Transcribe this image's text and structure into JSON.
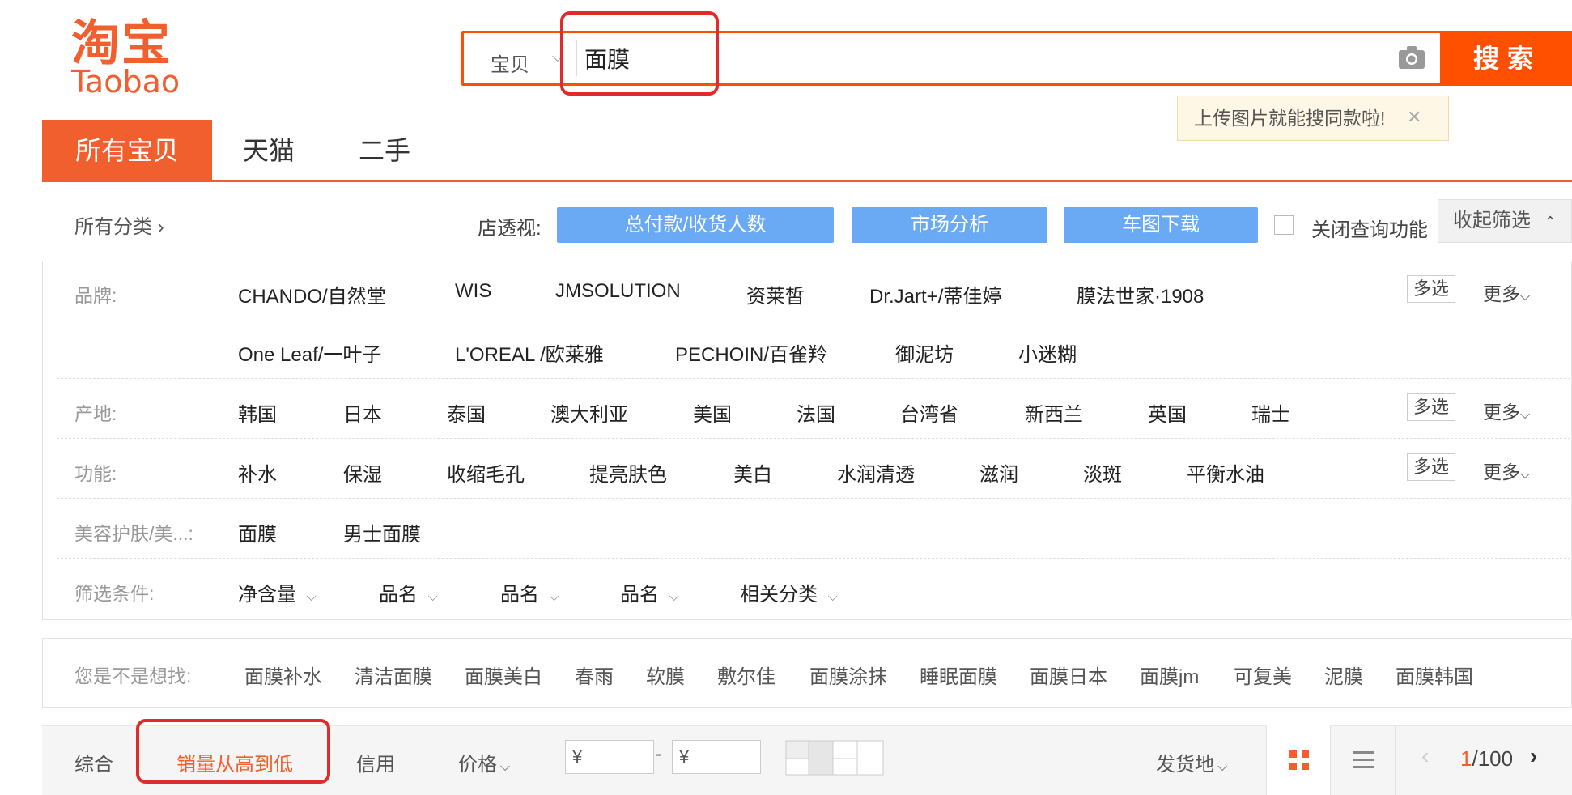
{
  "logo": {
    "cn": "淘宝",
    "en": "Taobao"
  },
  "search": {
    "type": "宝贝",
    "value": "面膜",
    "button": "搜索",
    "tooltip": "上传图片就能搜同款啦!"
  },
  "tabs": [
    {
      "label": "所有宝贝"
    },
    {
      "label": "天猫"
    },
    {
      "label": "二手"
    }
  ],
  "filter_header": {
    "all_categories": "所有分类",
    "shop_label": "店透视:",
    "buttons": [
      "总付款/收货人数",
      "市场分析",
      "车图下载"
    ],
    "close_query": "关闭查询功能",
    "collapse": "收起筛选"
  },
  "filters": {
    "brand": {
      "label": "品牌:",
      "row1": [
        "CHANDO/自然堂",
        "WIS",
        "JMSOLUTION",
        "资莱皙",
        "Dr.Jart+/蒂佳婷",
        "膜法世家·1908"
      ],
      "row2": [
        "One Leaf/一叶子",
        "L'OREAL /欧莱雅",
        "PECHOIN/百雀羚",
        "御泥坊",
        "小迷糊"
      ]
    },
    "origin": {
      "label": "产地:",
      "items": [
        "韩国",
        "日本",
        "泰国",
        "澳大利亚",
        "美国",
        "法国",
        "台湾省",
        "新西兰",
        "英国",
        "瑞士"
      ]
    },
    "function": {
      "label": "功能:",
      "items": [
        "补水",
        "保湿",
        "收缩毛孔",
        "提亮肤色",
        "美白",
        "水润清透",
        "滋润",
        "淡斑",
        "平衡水油"
      ]
    },
    "beauty": {
      "label": "美容护肤/美...:",
      "items": [
        "面膜",
        "男士面膜"
      ]
    },
    "conditions": {
      "label": "筛选条件:",
      "items": [
        "净含量",
        "品名",
        "品名",
        "品名",
        "相关分类"
      ]
    },
    "multi_select": "多选",
    "more": "更多"
  },
  "suggest": {
    "label": "您是不是想找:",
    "items": [
      "面膜补水",
      "清洁面膜",
      "面膜美白",
      "春雨",
      "软膜",
      "敷尔佳",
      "面膜涂抹",
      "睡眠面膜",
      "面膜日本",
      "面膜jm",
      "可复美",
      "泥膜",
      "面膜韩国"
    ]
  },
  "sort": {
    "comprehensive": "综合",
    "sales": "销量从高到低",
    "credit": "信用",
    "price": "价格",
    "price_min": "¥",
    "price_max": "¥",
    "dash": "-",
    "ship_from": "发货地",
    "page_current": "1",
    "page_total": "/100"
  },
  "colors": {
    "accent": "#f25f2e",
    "blue": "#6aa9f4",
    "annotation": "#e02b2b"
  }
}
